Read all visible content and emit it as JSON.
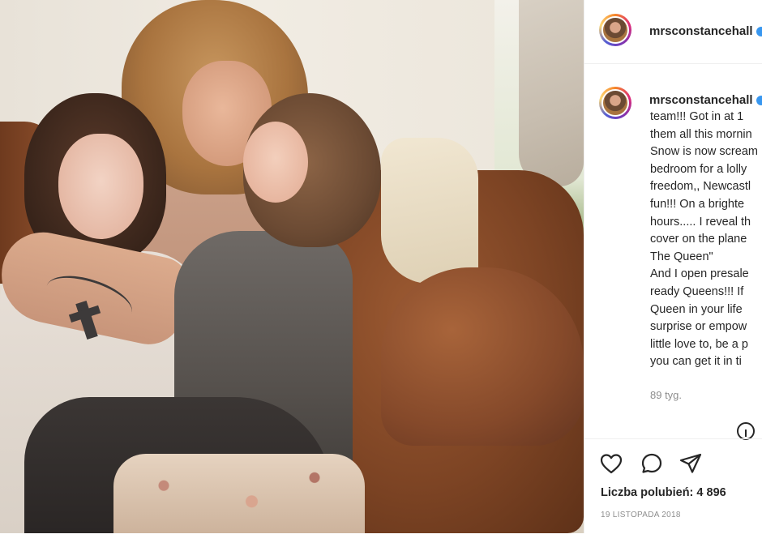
{
  "post": {
    "username": "mrsconstancehall",
    "caption_lines": [
      "team!!! Got in at 1",
      "them all this mornin",
      "Snow is now scream",
      "bedroom for a lolly",
      "freedom,, Newcastl",
      "fun!!! On a brighte",
      "hours..... I reveal th",
      "cover on the plane",
      "The Queen\"",
      "And I open presale",
      "ready Queens!!! If",
      "Queen in your life",
      "surprise or empow",
      "little love to, be a p",
      "you can get it in ti"
    ],
    "time_ago": "89 tyg.",
    "likes_text": "Liczba polubień: 4 896",
    "date": "19 LISTOPADA 2018"
  },
  "icons": {
    "avatar": "avatar",
    "verified": "verified-badge-icon",
    "like": "heart-icon",
    "comment": "comment-icon",
    "share": "paper-plane-icon",
    "more": "more-options-icon"
  },
  "colors": {
    "text": "#262626",
    "muted": "#8e8e8e",
    "border": "#efefef",
    "verified": "#3897f0"
  }
}
